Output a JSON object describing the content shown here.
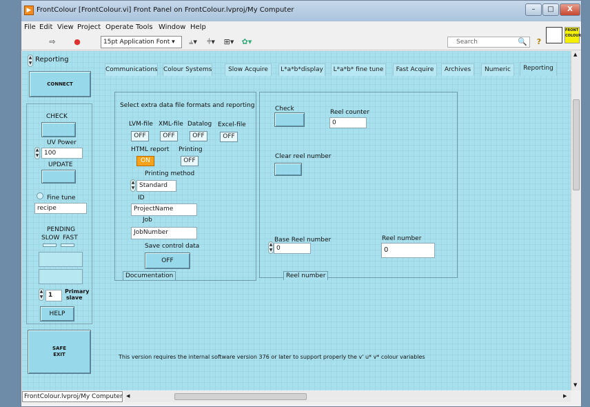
{
  "window": {
    "title": "FrontColour [FrontColour.vi] Front Panel on FrontColour.lvproj/My Computer",
    "minimize": "–",
    "maximize": "□",
    "close": "X"
  },
  "menu": [
    "File",
    "Edit",
    "View",
    "Project",
    "Operate",
    "Tools",
    "Window",
    "Help"
  ],
  "toolbar": {
    "font": "15pt Application Font",
    "search_placeholder": "Search",
    "logo_text": "FRONT COLOUR"
  },
  "left_panel": {
    "page_selector": "Reporting",
    "connect": "CONNECT",
    "check": "CHECK",
    "uv_power_label": "UV Power",
    "uv_power_value": "100",
    "update": "UPDATE",
    "fine_tune": "Fine tune",
    "recipe": "recipe",
    "pending": "PENDING",
    "slow": "SLOW",
    "fast": "FAST",
    "primary_value": "1",
    "primary_label": "Primary",
    "slave_label": "slave",
    "help": "HELP",
    "safe_exit_1": "SAFE",
    "safe_exit_2": "EXIT"
  },
  "tabs": [
    "Communications",
    "Colour Systems",
    "Slow Acquire",
    "L*a*b*display",
    "L*a*b* fine tune",
    "Fast Acquire",
    "Archives",
    "Numeric",
    "Reporting"
  ],
  "reporting": {
    "heading": "Select extra data file formats and  reporting",
    "lvm_label": "LVM-file",
    "lvm_value": "OFF",
    "xml_label": "XML-file",
    "xml_value": "OFF",
    "datalog_label": "Datalog",
    "datalog_value": "OFF",
    "excel_label": "Excel-file",
    "excel_value": "OFF",
    "html_label": "HTML report",
    "html_value": "ON",
    "printing_label": "Printing",
    "printing_value": "OFF",
    "printing_method_label": "Printing method",
    "printing_method_value": "Standard",
    "id_label": "ID",
    "id_value": "ProjectName",
    "job_label": "Job",
    "job_value": "JobNumber",
    "save_control_label": "Save control data",
    "save_control_value": "OFF",
    "documentation": "Documentation"
  },
  "reel": {
    "check": "Check",
    "reel_counter_label": "Reel counter",
    "reel_counter_value": "0",
    "clear_reel": "Clear reel number",
    "base_reel_label": "Base Reel number",
    "base_reel_value": "0",
    "reel_number_label": "Reel number",
    "reel_number_value": "0",
    "group_caption": "Reel number"
  },
  "footer_note": "This version requires the internal software version 376 or later to support properly the v' u* v* colour variables",
  "status_path": "FrontColour.lvproj/My Computer",
  "colors": {
    "panel": "#a8e0ee",
    "button": "#97d9ea",
    "on_toggle": "#f4a31a"
  }
}
